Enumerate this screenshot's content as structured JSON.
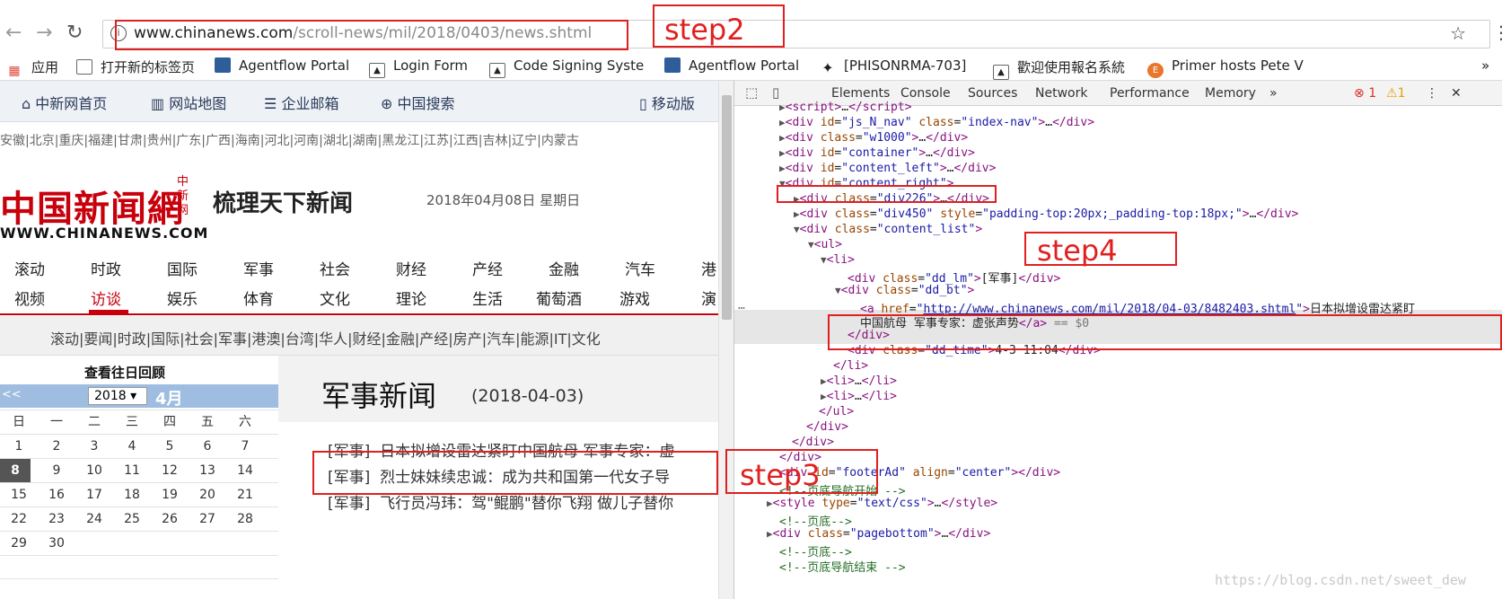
{
  "browser": {
    "url_host": "www.chinanews.com",
    "url_path": "/scroll-news/mil/2018/0403/news.shtml",
    "bookmarks": [
      {
        "label": "应用",
        "icon": "apps-grid-icon"
      },
      {
        "label": "打开新的标签页",
        "icon": "page-icon"
      },
      {
        "label": "Agentflow Portal",
        "icon": "portal-icon"
      },
      {
        "label": "Login Form",
        "icon": "image-icon"
      },
      {
        "label": "Code Signing Syste",
        "icon": "image-icon"
      },
      {
        "label": "Agentflow Portal",
        "icon": "portal-icon"
      },
      {
        "label": "[PHISONRMA-703]",
        "icon": "tool-icon"
      },
      {
        "label": "歡迎使用報名系統",
        "icon": "image-icon"
      },
      {
        "label": "Primer hosts Pete V",
        "icon": "e-icon"
      }
    ],
    "more_bookmarks": "»"
  },
  "page": {
    "topnav": [
      "中新网首页",
      "网站地图",
      "企业邮箱",
      "中国搜索",
      "移动版"
    ],
    "provinces": "安徽|北京|重庆|福建|甘肃|贵州|广东|广西|海南|河北|河南|湖北|湖南|黑龙江|江苏|江西|吉林|辽宁|内蒙古",
    "logo": "中国新闻網",
    "logo_small": "中新网",
    "logo_sub": "WWW.CHINANEWS.COM",
    "slogan": "梳理天下新闻",
    "date": "2018年04月08日 星期日",
    "menu_row1": [
      "滚动",
      "时政",
      "国际",
      "军事",
      "社会",
      "财经",
      "产经",
      "金融",
      "汽车",
      "港"
    ],
    "menu_row2": [
      "视频",
      "访谈",
      "娱乐",
      "体育",
      "文化",
      "理论",
      "生活",
      "葡萄酒",
      "游戏",
      "演"
    ],
    "subnav": "滚动|要闻|时政|国际|社会|军事|港澳|台湾|华人|财经|金融|产经|房产|汽车|能源|IT|文化",
    "calendar": {
      "title": "查看往日回顾",
      "prev": "<<",
      "year": "2018 ▾",
      "month": "4月",
      "weekdays": [
        "日",
        "一",
        "二",
        "三",
        "四",
        "五",
        "六"
      ],
      "weeks": [
        [
          "1",
          "2",
          "3",
          "4",
          "5",
          "6",
          "7"
        ],
        [
          "8",
          "9",
          "10",
          "11",
          "12",
          "13",
          "14"
        ],
        [
          "15",
          "16",
          "17",
          "18",
          "19",
          "20",
          "21"
        ],
        [
          "22",
          "23",
          "24",
          "25",
          "26",
          "27",
          "28"
        ],
        [
          "29",
          "30",
          "",
          "",
          "",
          "",
          ""
        ]
      ],
      "selected": "8"
    },
    "news_title": "军事新闻",
    "news_date": "(2018-04-03)",
    "news": [
      {
        "tag": "[军事]",
        "title": "日本拟增设雷达紧盯中国航母 军事专家：虚"
      },
      {
        "tag": "[军事]",
        "title": "烈士妹妹续忠诚：成为共和国第一代女子导"
      },
      {
        "tag": "[军事]",
        "title": "飞行员冯玮：驾\"鲲鹏\"替你飞翔 做儿子替你"
      }
    ]
  },
  "devtools": {
    "tabs": [
      "Elements",
      "Console",
      "Sources",
      "Network",
      "Performance",
      "Memory",
      "»"
    ],
    "errors": "1",
    "warnings": "1",
    "selected_link_text_1": "日本拟增设雷达紧盯",
    "selected_link_text_2": "中国航母 军事专家：虚张声势",
    "selected_href": "http://www.chinanews.com/mil/2018/04-03/8482403.shtml",
    "time_text": "4-3 11:04",
    "lm_text": "[军事]"
  },
  "annotations": {
    "step2": "step2",
    "step3": "step3",
    "step4": "step4",
    "watermark": "https://blog.csdn.net/sweet_dew"
  }
}
